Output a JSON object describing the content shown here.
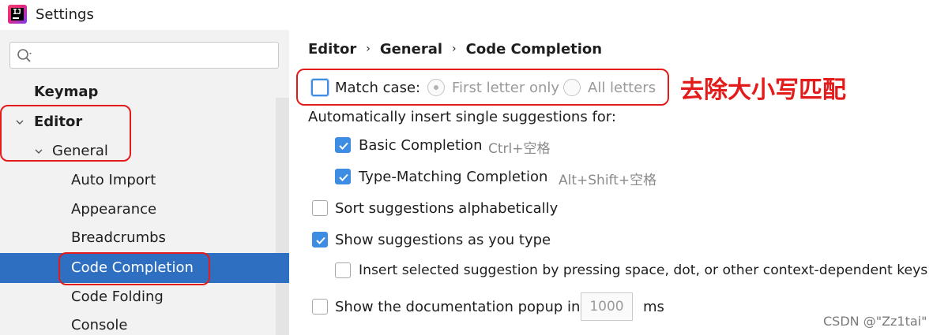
{
  "window": {
    "title": "Settings"
  },
  "sidebar": {
    "search_placeholder": "",
    "items": [
      {
        "label": "Keymap"
      },
      {
        "label": "Editor"
      },
      {
        "label": "General"
      },
      {
        "label": "Auto Import"
      },
      {
        "label": "Appearance"
      },
      {
        "label": "Breadcrumbs"
      },
      {
        "label": "Code Completion",
        "selected": true
      },
      {
        "label": "Code Folding"
      },
      {
        "label": "Console"
      }
    ]
  },
  "breadcrumb": {
    "items": [
      "Editor",
      "General",
      "Code Completion"
    ]
  },
  "options": {
    "match_case": {
      "label": "Match case:",
      "checked": false
    },
    "match_case_radios": [
      {
        "label": "First letter only",
        "selected": true,
        "enabled": false
      },
      {
        "label": "All letters",
        "selected": false,
        "enabled": false
      }
    ],
    "auto_insert_heading": "Automatically insert single suggestions for:",
    "basic_completion": {
      "label": "Basic Completion",
      "checked": true,
      "shortcut": "Ctrl+空格"
    },
    "type_matching": {
      "label": "Type-Matching Completion",
      "checked": true,
      "shortcut": "Alt+Shift+空格"
    },
    "sort_alpha": {
      "label": "Sort suggestions alphabetically",
      "checked": false
    },
    "show_as_type": {
      "label": "Show suggestions as you type",
      "checked": true
    },
    "insert_selected": {
      "label": "Insert selected suggestion by pressing space, dot, or other context-dependent keys",
      "checked": false
    },
    "doc_popup": {
      "label": "Show the documentation popup in",
      "value": "1000",
      "unit": "ms",
      "checked": false
    }
  },
  "annotation": {
    "callout_text": "去除大小写匹配",
    "color": "#e41b1b"
  },
  "watermark": "CSDN @\"Zz1tai\"",
  "colors": {
    "selection": "#2f6fc1",
    "checkbox": "#3d8ee2",
    "annotation": "#e41b1b"
  }
}
